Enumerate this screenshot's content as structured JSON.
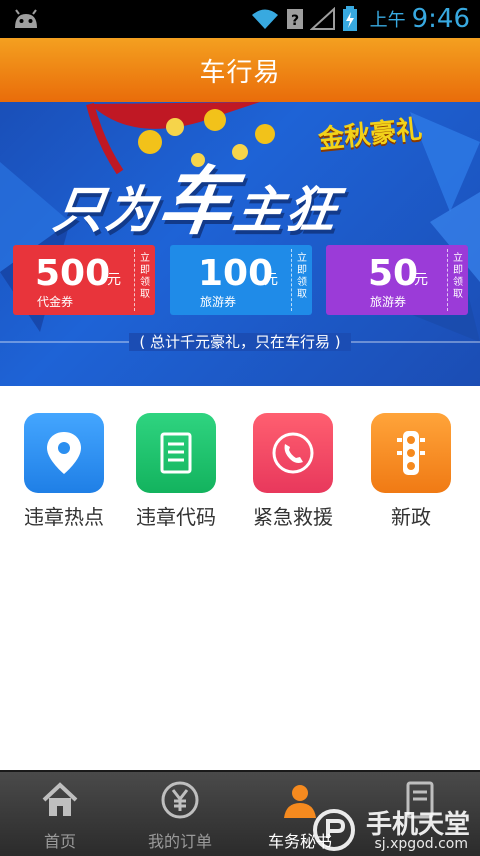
{
  "status_bar": {
    "ampm": "上午",
    "time": "9:46"
  },
  "header": {
    "title": "车行易"
  },
  "banner": {
    "promo_title": "金秋豪礼",
    "headline_part1": "只为",
    "headline_big": "车",
    "headline_part2": "主狂",
    "coupons": [
      {
        "amount": "500",
        "unit": "元",
        "type": "代金券",
        "side": "立即领取",
        "color": "#e8343b"
      },
      {
        "amount": "100",
        "unit": "元",
        "type": "旅游券",
        "side": "立即领取",
        "color": "#1f8be8"
      },
      {
        "amount": "50",
        "unit": "元",
        "type": "旅游券",
        "side": "立即领取",
        "color": "#9b3bd8"
      }
    ],
    "footer": "( 总计千元豪礼，只在车行易 )"
  },
  "services": [
    {
      "label": "违章热点",
      "icon": "location-pin-icon",
      "color": "#2b8ff0"
    },
    {
      "label": "违章代码",
      "icon": "document-list-icon",
      "color": "#1bbf6a"
    },
    {
      "label": "紧急救援",
      "icon": "phone-icon",
      "color": "#f0476a"
    },
    {
      "label": "新政",
      "icon": "traffic-light-icon",
      "color": "#f58a1f"
    }
  ],
  "tabbar": {
    "tabs": [
      {
        "label": "首页",
        "icon": "home-icon"
      },
      {
        "label": "我的订单",
        "icon": "yen-icon"
      },
      {
        "label": "车务秘书",
        "icon": "person-icon",
        "active": true
      },
      {
        "label": "",
        "icon": "document-icon"
      }
    ]
  },
  "watermark": {
    "title": "手机天堂",
    "url": "sj.xpgod.com"
  }
}
